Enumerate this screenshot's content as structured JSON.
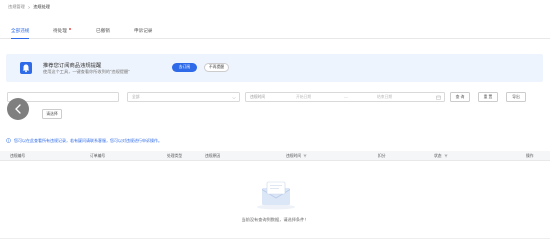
{
  "breadcrumb": {
    "parent": "违规管理",
    "separator": ">",
    "current": "违规处理"
  },
  "tabs": [
    {
      "label": "全部违规",
      "active": true,
      "badge": false
    },
    {
      "label": "待处理",
      "active": false,
      "badge": true
    },
    {
      "label": "已撤销",
      "active": false,
      "badge": false
    },
    {
      "label": "申诉记录",
      "active": false,
      "badge": false
    }
  ],
  "banner": {
    "title": "推荐您订阅商品违规提醒",
    "desc": "使用这个工具，一键查看你所收到的“违规提醒”",
    "primary_button": "去订阅",
    "secondary_button": "不再提醒"
  },
  "filters": {
    "select1": "",
    "select2": "全部",
    "date_label": "违规时间",
    "date_start": "开始日期",
    "range_sep": "—",
    "date_end": "结束日期",
    "search_button": "查 询",
    "reset_button": "重 置",
    "export_button": "导出",
    "select3": "请选择"
  },
  "info": {
    "text": "您可以在此查看所有违规记录，若有疑问请联系客服，您可以对违规进行申诉操作。"
  },
  "table": {
    "headers": [
      {
        "label": "违规编号",
        "filter": false
      },
      {
        "label": "订单编号",
        "filter": false
      },
      {
        "label": "处理类型",
        "filter": false
      },
      {
        "label": "违规原因",
        "filter": false
      },
      {
        "label": "违规时间",
        "filter": true
      },
      {
        "label": "扣分",
        "filter": false
      },
      {
        "label": "状态",
        "filter": true
      },
      {
        "label": "操作",
        "filter": false
      }
    ]
  },
  "empty": {
    "text": "当前没有查询到数据，请选择条件！"
  },
  "colors": {
    "accent": "#2f6be8",
    "banner_bg": "#eef4fd",
    "header_bg": "#f5f6f8",
    "badge": "#e84a4a"
  }
}
